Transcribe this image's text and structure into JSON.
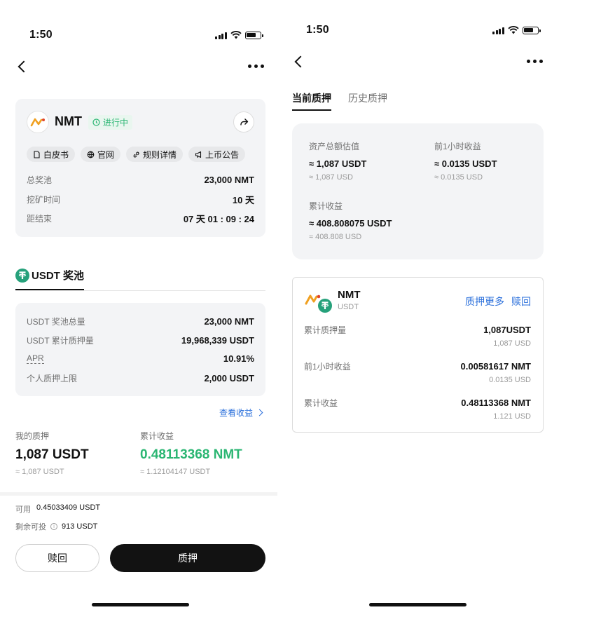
{
  "left": {
    "status_time": "1:50",
    "project": {
      "name": "NMT",
      "status": "进行中",
      "links": [
        "白皮书",
        "官网",
        "规则详情",
        "上币公告"
      ],
      "rows": [
        {
          "label": "总奖池",
          "value": "23,000 NMT"
        },
        {
          "label": "挖矿时间",
          "value": "10 天"
        },
        {
          "label": "距结束",
          "value": "07 天 01 : 09 : 24"
        }
      ]
    },
    "pool_tab": "USDT 奖池",
    "pool_rows": [
      {
        "label": "USDT 奖池总量",
        "value": "23,000 NMT"
      },
      {
        "label": "USDT 累计质押量",
        "value": "19,968,339 USDT"
      },
      {
        "label": "APR",
        "value": "10.91%"
      },
      {
        "label": "个人质押上限",
        "value": "2,000 USDT"
      }
    ],
    "view_earnings": "查看收益",
    "my_stake": {
      "label": "我的质押",
      "value": "1,087 USDT",
      "sub": "≈ 1,087 USDT"
    },
    "earnings": {
      "label": "累计收益",
      "value": "0.48113368 NMT",
      "sub": "≈ 1.12104147 USDT"
    },
    "available": {
      "label": "可用",
      "value": "0.45033409 USDT"
    },
    "remaining": {
      "label": "剩余可投",
      "value": "913 USDT"
    },
    "redeem_button": "赎回",
    "stake_button": "质押"
  },
  "right": {
    "status_time": "1:50",
    "tabs": [
      "当前质押",
      "历史质押"
    ],
    "summary": [
      {
        "label": "资产总额估值",
        "value": "≈ 1,087 USDT",
        "sub": "≈ 1,087 USD"
      },
      {
        "label": "前1小时收益",
        "value": "≈ 0.0135 USDT",
        "sub": "≈ 0.0135 USD"
      },
      {
        "label": "累计收益",
        "value": "≈ 408.808075 USDT",
        "sub": "≈ 408.808 USD"
      }
    ],
    "position": {
      "name": "NMT",
      "sub": "USDT",
      "more_link": "质押更多",
      "redeem_link": "赎回",
      "rows": [
        {
          "label": "累计质押量",
          "value": "1,087USDT",
          "sub": "1,087 USD"
        },
        {
          "label": "前1小时收益",
          "value": "0.00581617 NMT",
          "sub": "0.0135 USD"
        },
        {
          "label": "累计收益",
          "value": "0.48113368 NMT",
          "sub": "1.121 USD"
        }
      ]
    }
  },
  "colors": {
    "accent_green": "#2bb673",
    "link_blue": "#2a6fdb",
    "tether": "#26a17b"
  }
}
